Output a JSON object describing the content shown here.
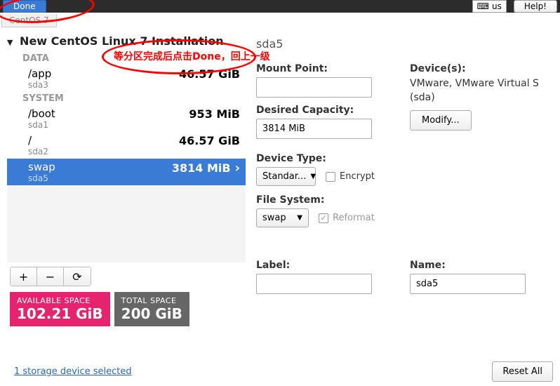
{
  "top": {
    "done": "Done",
    "kbd": "us",
    "help": "Help!",
    "tab": "CentOS 7"
  },
  "annotation": "等分区完成后点击Done，回上一级",
  "left": {
    "header": "New CentOS Linux 7 Installation",
    "data_label": "DATA",
    "system_label": "SYSTEM",
    "partitions": {
      "data": [
        {
          "mount": "/app",
          "dev": "sda3",
          "size": "46.57 GiB"
        }
      ],
      "system": [
        {
          "mount": "/boot",
          "dev": "sda1",
          "size": "953 MiB"
        },
        {
          "mount": "/",
          "dev": "sda2",
          "size": "46.57 GiB"
        },
        {
          "mount": "swap",
          "dev": "sda5",
          "size": "3814 MiB"
        }
      ]
    },
    "buttons": {
      "add": "+",
      "remove": "−",
      "reload": "⟳"
    },
    "avail_label": "AVAILABLE SPACE",
    "avail_val": "102.21 GiB",
    "total_label": "TOTAL SPACE",
    "total_val": "200 GiB"
  },
  "right": {
    "selected": "sda5",
    "mount_label": "Mount Point:",
    "mount_val": "",
    "capacity_label": "Desired Capacity:",
    "capacity_val": "3814 MiB",
    "devices_label": "Device(s):",
    "devices_text": "VMware, VMware Virtual S (sda)",
    "modify": "Modify...",
    "dtype_label": "Device Type:",
    "dtype_val": "Standar...",
    "encrypt": "Encrypt",
    "fs_label": "File System:",
    "fs_val": "swap",
    "reformat": "Reformat",
    "label_label": "Label:",
    "label_val": "",
    "name_label": "Name:",
    "name_val": "sda5"
  },
  "bottom": {
    "link": "1 storage device selected",
    "reset": "Reset All"
  }
}
